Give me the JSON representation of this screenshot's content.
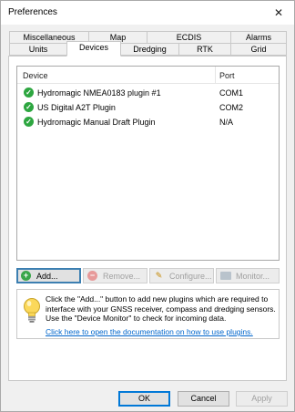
{
  "window": {
    "title": "Preferences",
    "close_glyph": "✕"
  },
  "tabs_row1": [
    {
      "label": "Miscellaneous"
    },
    {
      "label": "Map"
    },
    {
      "label": "ECDIS"
    },
    {
      "label": "Alarms"
    }
  ],
  "tabs_row2": [
    {
      "label": "Units"
    },
    {
      "label": "Devices",
      "active": true
    },
    {
      "label": "Dredging"
    },
    {
      "label": "RTK"
    },
    {
      "label": "Grid"
    }
  ],
  "device_list": {
    "columns": [
      "Device",
      "Port"
    ],
    "rows": [
      {
        "device": "Hydromagic NMEA0183 plugin #1",
        "port": "COM1",
        "status_icon": "check-circle-icon"
      },
      {
        "device": "US Digital A2T Plugin",
        "port": "COM2",
        "status_icon": "check-circle-icon"
      },
      {
        "device": "Hydromagic Manual Draft Plugin",
        "port": "N/A",
        "status_icon": "check-circle-icon"
      }
    ]
  },
  "actions": {
    "add": "Add...",
    "remove": "Remove...",
    "configure": "Configure...",
    "monitor": "Monitor..."
  },
  "info": {
    "text": "Click the \"Add...\" button to add new plugins which are required to interface with your GNSS receiver, compass and dredging sensors. Use the \"Device Monitor\" to check for incoming data.",
    "link": "Click here to open the documentation on how to use plugins."
  },
  "dialog_buttons": {
    "ok": "OK",
    "cancel": "Cancel",
    "apply": "Apply"
  },
  "colors": {
    "accent": "#0078d7",
    "status_ok": "#2da640",
    "link": "#0066cc"
  }
}
